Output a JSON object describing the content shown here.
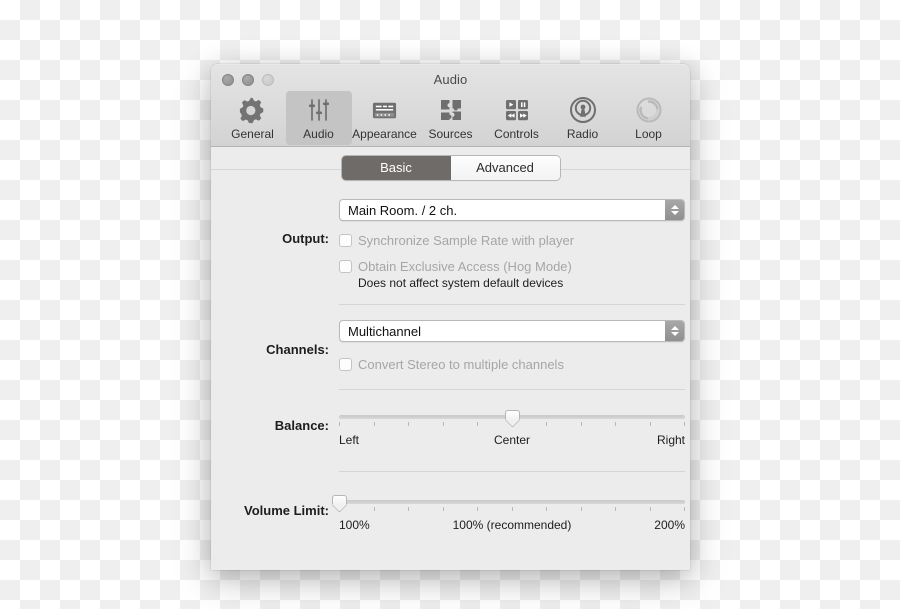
{
  "window": {
    "title": "Audio",
    "traffic_lights": [
      "close",
      "minimize",
      "zoom"
    ]
  },
  "toolbar": {
    "items": [
      {
        "label": "General",
        "icon": "gear-icon",
        "selected": false
      },
      {
        "label": "Audio",
        "icon": "sliders-icon",
        "selected": true
      },
      {
        "label": "Appearance",
        "icon": "appearance-icon",
        "selected": false
      },
      {
        "label": "Sources",
        "icon": "puzzle-icon",
        "selected": false
      },
      {
        "label": "Controls",
        "icon": "playback-grid-icon",
        "selected": false
      },
      {
        "label": "Radio",
        "icon": "broadcast-icon",
        "selected": false
      },
      {
        "label": "Loop",
        "icon": "loop-icon",
        "selected": false
      }
    ]
  },
  "tabs": {
    "basic": "Basic",
    "advanced": "Advanced",
    "selected": "Basic"
  },
  "output": {
    "label": "Output:",
    "device": "Main Room. / 2 ch.",
    "sync_sample_rate": "Synchronize Sample Rate with player",
    "hog_mode": "Obtain Exclusive Access (Hog Mode)",
    "hog_hint": "Does not affect system default devices"
  },
  "channels": {
    "label": "Channels:",
    "mode": "Multichannel",
    "convert_stereo": "Convert Stereo to multiple channels"
  },
  "balance": {
    "label": "Balance:",
    "left": "Left",
    "center": "Center",
    "right": "Right",
    "value_percent": 50,
    "tick_count": 11
  },
  "volume_limit": {
    "label": "Volume Limit:",
    "min": "100%",
    "recommended": "100% (recommended)",
    "max": "200%",
    "value_percent": 0,
    "tick_count": 11
  },
  "colors": {
    "window_body": "#ececec",
    "titlebar_top": "#e4e4e4",
    "titlebar_bottom": "#d3d3d3",
    "selected_tab": "#6e6b69",
    "toolbar_selected": "#c4c4c4",
    "disabled_text": "#a6a6a6",
    "icon_gray": "#757575"
  }
}
